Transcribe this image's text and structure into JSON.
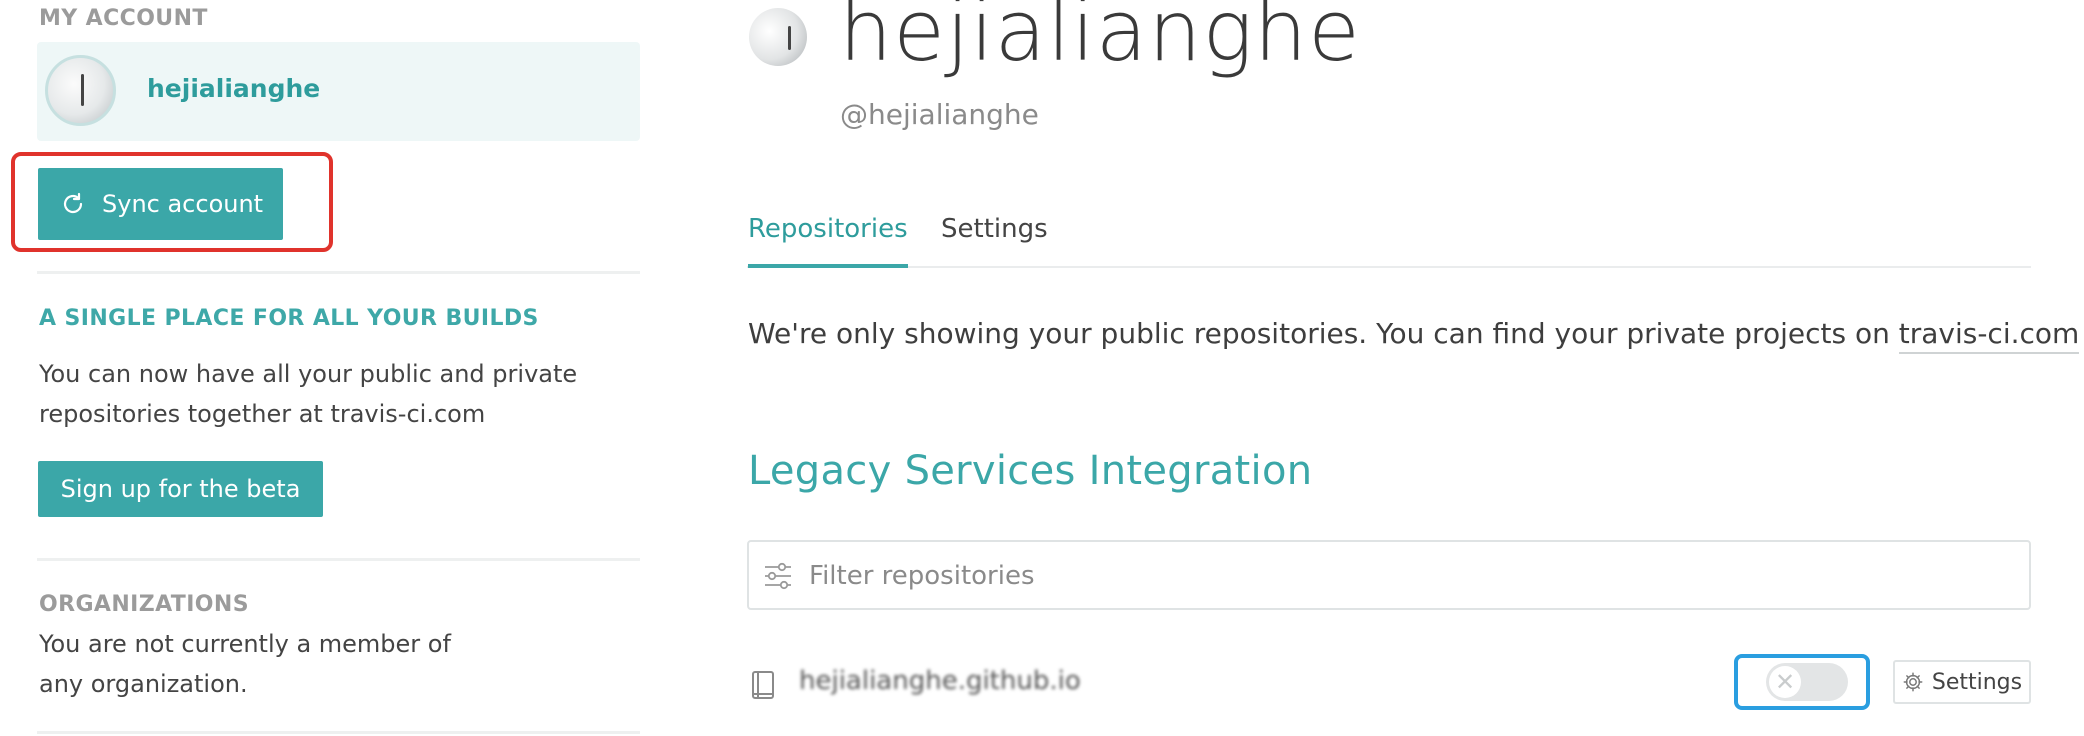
{
  "sidebar": {
    "my_account_heading": "MY ACCOUNT",
    "account_name": "hejialianghe",
    "sync_button_label": "Sync account",
    "builds_heading": "A SINGLE PLACE FOR ALL YOUR BUILDS",
    "builds_text": "You can now have all your public and private repositories together at travis-ci.com",
    "beta_button_label": "Sign up for the beta",
    "organizations_heading": "ORGANIZATIONS",
    "organizations_text": "You are not currently a member of any organization."
  },
  "profile": {
    "name": "hejialianghe",
    "handle": "@hejialianghe"
  },
  "tabs": [
    {
      "label": "Repositories",
      "active": true
    },
    {
      "label": "Settings",
      "active": false
    }
  ],
  "notice": {
    "text": "We're only showing your public repositories. You can find your private projects on ",
    "link_text": "travis-ci.com",
    "suffix": " ."
  },
  "legacy": {
    "title": "Legacy Services Integration",
    "filter_placeholder": "Filter repositories"
  },
  "repositories": [
    {
      "name": "hejialianghe.github.io",
      "enabled": false,
      "settings_label": "Settings"
    }
  ],
  "icons": {
    "sync": "refresh-icon",
    "filter": "sliders-icon",
    "repo": "book-icon",
    "settings": "gear-icon",
    "toggle_off": "x-icon"
  },
  "colors": {
    "accent": "#3ba7a8",
    "highlight_red": "#e0332c",
    "highlight_blue": "#2a9ee0"
  }
}
